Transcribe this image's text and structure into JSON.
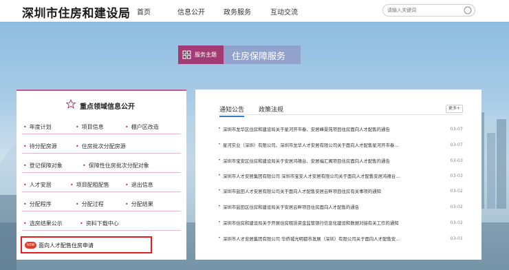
{
  "header": {
    "logo": "深圳市住房和建设局",
    "nav": [
      "首页",
      "信息公开",
      "政务服务",
      "互动交流"
    ],
    "search_placeholder": "请输入关键词"
  },
  "banner": {
    "tag": "服务主题",
    "title": "住房保障服务"
  },
  "left_panel": {
    "title": "重点领域信息公开",
    "links": [
      [
        "年度计划",
        "项目信息",
        "棚户区改造"
      ],
      [
        "待分配房源",
        "住房批次分配房源"
      ],
      [
        "登记保障对象",
        "保障性住房批次分配对象"
      ],
      [
        "人才安居",
        "项目配租配售",
        "退出信息"
      ],
      [
        "分配程序",
        "分配过程",
        "分配结果"
      ],
      [
        "选房结果公示",
        "资料下载中心"
      ]
    ],
    "special_badge": "NEW",
    "special_link": "面向人才配售住房申请"
  },
  "right_panel": {
    "tabs": [
      "通知公告",
      "政策法规"
    ],
    "more": "更多+",
    "news": [
      {
        "title": "深圳市龙华区住房和建设局关于星河开市春、安居峰景苑项目住房面向人才配售的通告",
        "date": "03-07"
      },
      {
        "title": "星河实业（深圳）有限公司、深圳市龙华人才安居有限公司关于面向人才配售星河开市春...",
        "date": "03-07"
      },
      {
        "title": "深圳市宝安区住房和建设局关于安居鸿禧台、安居福汇阁项目住房面向人才配售的通告",
        "date": "03-03"
      },
      {
        "title": "深圳市人才安居集团有限公司 深圳市宝安人才安居有限公司关于面向人才配售安居鸿禧台...",
        "date": "03-03"
      },
      {
        "title": "深圳市盐田人才安居有限公司关于面向人才配售安居云畔项目住房有关事项的通知",
        "date": "03-02"
      },
      {
        "title": "深圳市盐田区住房和建设局关于安居云畔项目住房面向人才配售的通告",
        "date": "03-02"
      },
      {
        "title": "深圳市住房和建设局关于开展住房租赁资金监管银行信息化建设和数据对接有关工作的通知",
        "date": "03-02"
      },
      {
        "title": "深圳市人才安居集团有限公司 华侨城光明都市发展（深圳）有限公司关于面向人才配售安...",
        "date": "03-01"
      }
    ]
  }
}
